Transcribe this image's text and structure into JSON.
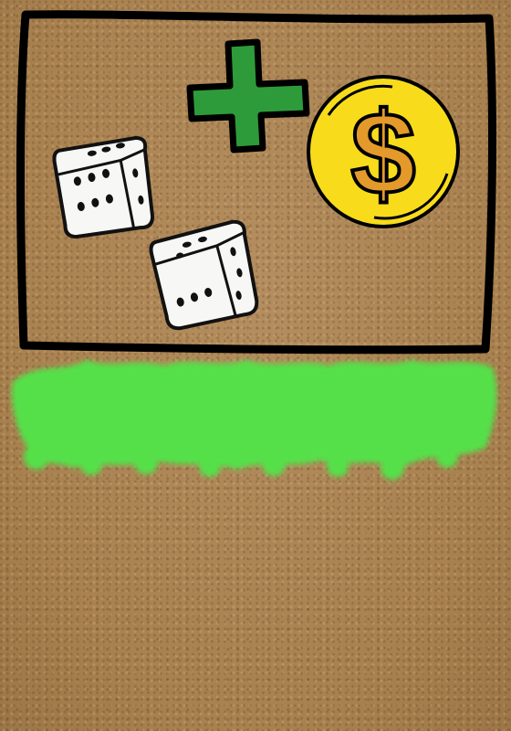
{
  "card": {
    "background_color": "#b0895a",
    "frame_color": "#000000",
    "plus_color": "#2e9b3a",
    "coin_color": "#f8dc1c",
    "dollar_color": "#e39a2a",
    "grass_color": "#55e04a"
  },
  "icons": [
    "plus-icon",
    "dollar-coin-icon",
    "dice-icon",
    "dice-icon",
    "grass-strip"
  ],
  "coin": {
    "symbol": "$"
  },
  "dice": [
    {
      "pips": 6
    },
    {
      "pips": 6
    }
  ]
}
